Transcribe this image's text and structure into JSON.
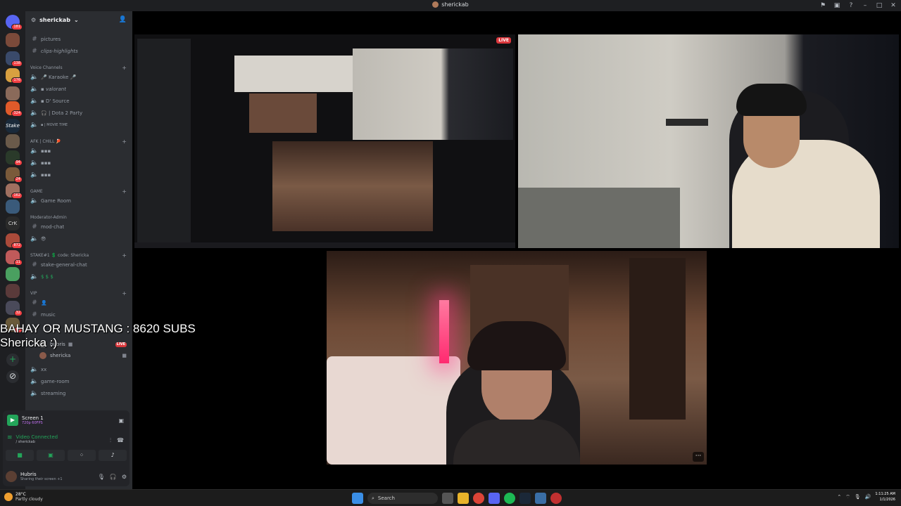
{
  "window": {
    "title": "sherickab"
  },
  "server": {
    "name": "sherickab"
  },
  "rail": {
    "badges": [
      "181",
      "138",
      "176",
      "324",
      "94",
      "24",
      "162",
      "872",
      "11",
      "32",
      "52"
    ]
  },
  "channels": {
    "top_items": [
      {
        "icon": "#",
        "label": "pictures"
      },
      {
        "icon": "#",
        "label": "clips-highlights"
      }
    ],
    "voice_category": "Voice Channels",
    "voice_items": [
      "🎤 Karaoke 🎤",
      "▪ valorant",
      "▪ D' Source",
      "🎧 | Dota 2 Party",
      "▪ | MOVIE TIME"
    ],
    "afk_category": "AFK | CHILL 🏓",
    "afk_items": [
      "▪▪▪",
      "▪▪▪",
      "▪▪▪"
    ],
    "game_category": "GAME",
    "game_items": [
      "Game Room"
    ],
    "mod_category": "Moderator-Admin",
    "mod_items": [
      "mod-chat",
      "😎"
    ],
    "stake_category": "STAKE#1 💲 code: Shericka",
    "stake_items": [
      "stake-general-chat",
      "$ $ $"
    ],
    "vip_category": "VIP",
    "vip_items": [
      "👤",
      "music"
    ],
    "voice_users": [
      {
        "name": "hubris",
        "live": "LIVE"
      },
      {
        "name": "shericka",
        "live": ""
      }
    ],
    "bottom_items": [
      "xx",
      "game-room",
      "streaming"
    ]
  },
  "voice_panel": {
    "screen_title": "Screen 1",
    "screen_sub": "720p 60FPS",
    "status": "Video Connected",
    "channel": "/ sherickab"
  },
  "user": {
    "name": "Hubris",
    "status": "Sharing their screen +1"
  },
  "overlay": {
    "line1": "BAHAY OR MUSTANG : 8620 SUBS",
    "line2": "Shericka :)"
  },
  "stage": {
    "live_label": "LIVE",
    "more_label": "···"
  },
  "taskbar": {
    "weather_temp": "28°C",
    "weather_desc": "Partly cloudy",
    "search": "Search",
    "time": "1:11:25 AM",
    "date": "1/1/2026"
  },
  "colors": {
    "accent_green": "#23a55a",
    "live_red": "#da373c",
    "bg_sidebar": "#2b2d31",
    "bg_rail": "#1e1f22"
  }
}
